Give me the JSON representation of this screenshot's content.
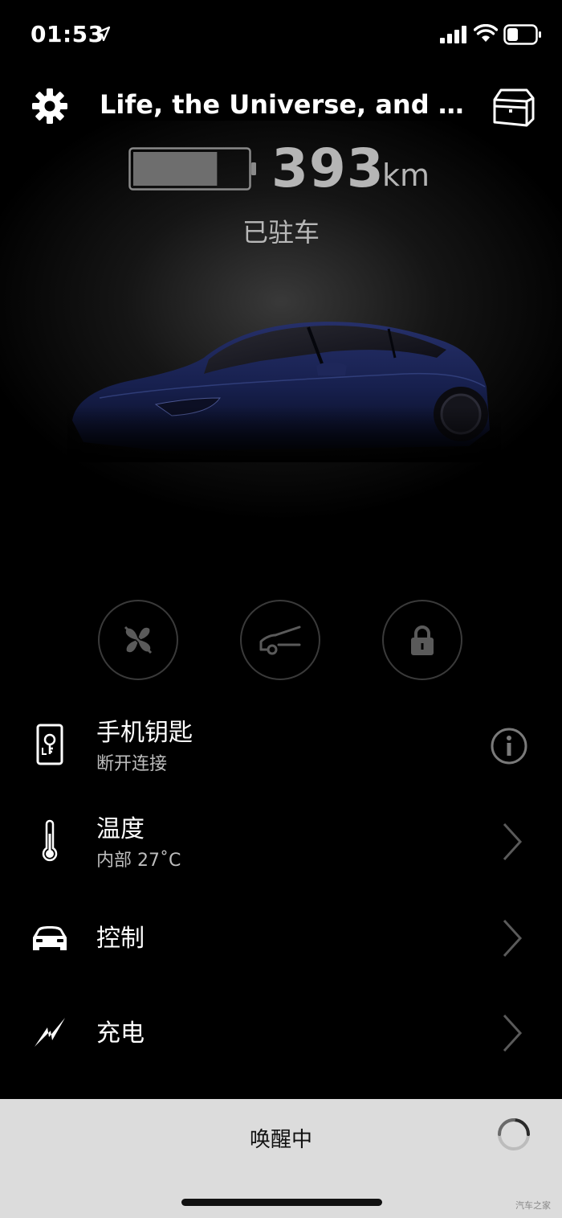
{
  "status_bar": {
    "time": "01:53",
    "icons": [
      "location-arrow-icon",
      "cellular-signal-icon",
      "wifi-icon",
      "battery-icon"
    ]
  },
  "header": {
    "settings_icon": "gear-icon",
    "car_name": "Life, the Universe, and Ev...",
    "toolbox_icon": "toolbox-icon"
  },
  "vehicle": {
    "battery_level_fraction": 0.74,
    "range_value": "393",
    "range_unit": "km",
    "status": "已驻车",
    "car_color": "#1a2452"
  },
  "quick_actions": [
    {
      "icon": "fan-icon",
      "name": "climate"
    },
    {
      "icon": "frunk-icon",
      "name": "frunk"
    },
    {
      "icon": "lock-icon",
      "name": "lock"
    }
  ],
  "menu": {
    "phone_key": {
      "title": "手机钥匙",
      "subtitle": "断开连接",
      "icon": "phone-key-icon",
      "action_icon": "info-icon"
    },
    "climate": {
      "title": "温度",
      "subtitle": "内部 27˚C",
      "icon": "thermometer-icon",
      "action_icon": "chevron-right-icon"
    },
    "controls": {
      "title": "控制",
      "icon": "car-front-icon",
      "action_icon": "chevron-right-icon"
    },
    "charging": {
      "title": "充电",
      "icon": "lightning-icon",
      "action_icon": "chevron-right-icon"
    }
  },
  "bottom_bar": {
    "wake_text": "唤醒中",
    "spinner_icon": "spinner-icon",
    "watermark": "汽车之家"
  },
  "colors": {
    "background": "#000000",
    "bottom_bar": "#dcdcdc",
    "muted_text": "#b5b5b5"
  }
}
